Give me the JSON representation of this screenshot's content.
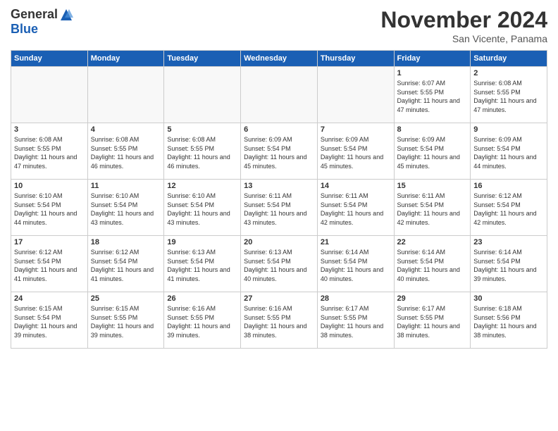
{
  "header": {
    "logo_general": "General",
    "logo_blue": "Blue",
    "month_title": "November 2024",
    "location": "San Vicente, Panama"
  },
  "calendar": {
    "days_of_week": [
      "Sunday",
      "Monday",
      "Tuesday",
      "Wednesday",
      "Thursday",
      "Friday",
      "Saturday"
    ],
    "weeks": [
      [
        {
          "day": "",
          "empty": true
        },
        {
          "day": "",
          "empty": true
        },
        {
          "day": "",
          "empty": true
        },
        {
          "day": "",
          "empty": true
        },
        {
          "day": "",
          "empty": true
        },
        {
          "day": "1",
          "sunrise": "6:07 AM",
          "sunset": "5:55 PM",
          "daylight": "11 hours and 47 minutes."
        },
        {
          "day": "2",
          "sunrise": "6:08 AM",
          "sunset": "5:55 PM",
          "daylight": "11 hours and 47 minutes."
        }
      ],
      [
        {
          "day": "3",
          "sunrise": "6:08 AM",
          "sunset": "5:55 PM",
          "daylight": "11 hours and 47 minutes."
        },
        {
          "day": "4",
          "sunrise": "6:08 AM",
          "sunset": "5:55 PM",
          "daylight": "11 hours and 46 minutes."
        },
        {
          "day": "5",
          "sunrise": "6:08 AM",
          "sunset": "5:55 PM",
          "daylight": "11 hours and 46 minutes."
        },
        {
          "day": "6",
          "sunrise": "6:09 AM",
          "sunset": "5:54 PM",
          "daylight": "11 hours and 45 minutes."
        },
        {
          "day": "7",
          "sunrise": "6:09 AM",
          "sunset": "5:54 PM",
          "daylight": "11 hours and 45 minutes."
        },
        {
          "day": "8",
          "sunrise": "6:09 AM",
          "sunset": "5:54 PM",
          "daylight": "11 hours and 45 minutes."
        },
        {
          "day": "9",
          "sunrise": "6:09 AM",
          "sunset": "5:54 PM",
          "daylight": "11 hours and 44 minutes."
        }
      ],
      [
        {
          "day": "10",
          "sunrise": "6:10 AM",
          "sunset": "5:54 PM",
          "daylight": "11 hours and 44 minutes."
        },
        {
          "day": "11",
          "sunrise": "6:10 AM",
          "sunset": "5:54 PM",
          "daylight": "11 hours and 43 minutes."
        },
        {
          "day": "12",
          "sunrise": "6:10 AM",
          "sunset": "5:54 PM",
          "daylight": "11 hours and 43 minutes."
        },
        {
          "day": "13",
          "sunrise": "6:11 AM",
          "sunset": "5:54 PM",
          "daylight": "11 hours and 43 minutes."
        },
        {
          "day": "14",
          "sunrise": "6:11 AM",
          "sunset": "5:54 PM",
          "daylight": "11 hours and 42 minutes."
        },
        {
          "day": "15",
          "sunrise": "6:11 AM",
          "sunset": "5:54 PM",
          "daylight": "11 hours and 42 minutes."
        },
        {
          "day": "16",
          "sunrise": "6:12 AM",
          "sunset": "5:54 PM",
          "daylight": "11 hours and 42 minutes."
        }
      ],
      [
        {
          "day": "17",
          "sunrise": "6:12 AM",
          "sunset": "5:54 PM",
          "daylight": "11 hours and 41 minutes."
        },
        {
          "day": "18",
          "sunrise": "6:12 AM",
          "sunset": "5:54 PM",
          "daylight": "11 hours and 41 minutes."
        },
        {
          "day": "19",
          "sunrise": "6:13 AM",
          "sunset": "5:54 PM",
          "daylight": "11 hours and 41 minutes."
        },
        {
          "day": "20",
          "sunrise": "6:13 AM",
          "sunset": "5:54 PM",
          "daylight": "11 hours and 40 minutes."
        },
        {
          "day": "21",
          "sunrise": "6:14 AM",
          "sunset": "5:54 PM",
          "daylight": "11 hours and 40 minutes."
        },
        {
          "day": "22",
          "sunrise": "6:14 AM",
          "sunset": "5:54 PM",
          "daylight": "11 hours and 40 minutes."
        },
        {
          "day": "23",
          "sunrise": "6:14 AM",
          "sunset": "5:54 PM",
          "daylight": "11 hours and 39 minutes."
        }
      ],
      [
        {
          "day": "24",
          "sunrise": "6:15 AM",
          "sunset": "5:54 PM",
          "daylight": "11 hours and 39 minutes."
        },
        {
          "day": "25",
          "sunrise": "6:15 AM",
          "sunset": "5:55 PM",
          "daylight": "11 hours and 39 minutes."
        },
        {
          "day": "26",
          "sunrise": "6:16 AM",
          "sunset": "5:55 PM",
          "daylight": "11 hours and 39 minutes."
        },
        {
          "day": "27",
          "sunrise": "6:16 AM",
          "sunset": "5:55 PM",
          "daylight": "11 hours and 38 minutes."
        },
        {
          "day": "28",
          "sunrise": "6:17 AM",
          "sunset": "5:55 PM",
          "daylight": "11 hours and 38 minutes."
        },
        {
          "day": "29",
          "sunrise": "6:17 AM",
          "sunset": "5:55 PM",
          "daylight": "11 hours and 38 minutes."
        },
        {
          "day": "30",
          "sunrise": "6:18 AM",
          "sunset": "5:56 PM",
          "daylight": "11 hours and 38 minutes."
        }
      ]
    ]
  }
}
